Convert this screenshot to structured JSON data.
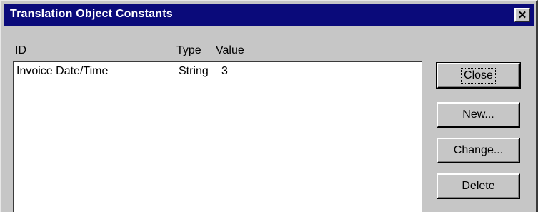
{
  "window": {
    "title": "Translation Object Constants",
    "close_glyph": "✕"
  },
  "columns": {
    "id": "ID",
    "type": "Type",
    "value": "Value"
  },
  "rows": [
    {
      "id": "Invoice Date/Time",
      "type": "String",
      "value": "3"
    }
  ],
  "buttons": {
    "close": "Close",
    "new": "New...",
    "change": "Change...",
    "delete": "Delete"
  },
  "colors": {
    "title_bar": "#0a0a7a",
    "face": "#c6c6c6"
  }
}
